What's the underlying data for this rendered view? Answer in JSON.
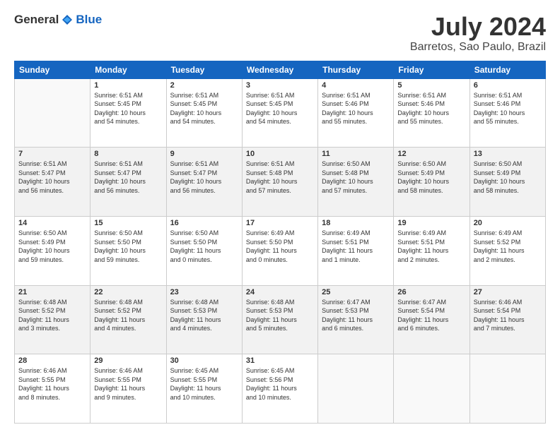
{
  "header": {
    "logo_general": "General",
    "logo_blue": "Blue",
    "month": "July 2024",
    "location": "Barretos, Sao Paulo, Brazil"
  },
  "days_of_week": [
    "Sunday",
    "Monday",
    "Tuesday",
    "Wednesday",
    "Thursday",
    "Friday",
    "Saturday"
  ],
  "weeks": [
    [
      {
        "day": "",
        "info": ""
      },
      {
        "day": "1",
        "info": "Sunrise: 6:51 AM\nSunset: 5:45 PM\nDaylight: 10 hours\nand 54 minutes."
      },
      {
        "day": "2",
        "info": "Sunrise: 6:51 AM\nSunset: 5:45 PM\nDaylight: 10 hours\nand 54 minutes."
      },
      {
        "day": "3",
        "info": "Sunrise: 6:51 AM\nSunset: 5:45 PM\nDaylight: 10 hours\nand 54 minutes."
      },
      {
        "day": "4",
        "info": "Sunrise: 6:51 AM\nSunset: 5:46 PM\nDaylight: 10 hours\nand 55 minutes."
      },
      {
        "day": "5",
        "info": "Sunrise: 6:51 AM\nSunset: 5:46 PM\nDaylight: 10 hours\nand 55 minutes."
      },
      {
        "day": "6",
        "info": "Sunrise: 6:51 AM\nSunset: 5:46 PM\nDaylight: 10 hours\nand 55 minutes."
      }
    ],
    [
      {
        "day": "7",
        "info": "Sunrise: 6:51 AM\nSunset: 5:47 PM\nDaylight: 10 hours\nand 56 minutes."
      },
      {
        "day": "8",
        "info": "Sunrise: 6:51 AM\nSunset: 5:47 PM\nDaylight: 10 hours\nand 56 minutes."
      },
      {
        "day": "9",
        "info": "Sunrise: 6:51 AM\nSunset: 5:47 PM\nDaylight: 10 hours\nand 56 minutes."
      },
      {
        "day": "10",
        "info": "Sunrise: 6:51 AM\nSunset: 5:48 PM\nDaylight: 10 hours\nand 57 minutes."
      },
      {
        "day": "11",
        "info": "Sunrise: 6:50 AM\nSunset: 5:48 PM\nDaylight: 10 hours\nand 57 minutes."
      },
      {
        "day": "12",
        "info": "Sunrise: 6:50 AM\nSunset: 5:49 PM\nDaylight: 10 hours\nand 58 minutes."
      },
      {
        "day": "13",
        "info": "Sunrise: 6:50 AM\nSunset: 5:49 PM\nDaylight: 10 hours\nand 58 minutes."
      }
    ],
    [
      {
        "day": "14",
        "info": "Sunrise: 6:50 AM\nSunset: 5:49 PM\nDaylight: 10 hours\nand 59 minutes."
      },
      {
        "day": "15",
        "info": "Sunrise: 6:50 AM\nSunset: 5:50 PM\nDaylight: 10 hours\nand 59 minutes."
      },
      {
        "day": "16",
        "info": "Sunrise: 6:50 AM\nSunset: 5:50 PM\nDaylight: 11 hours\nand 0 minutes."
      },
      {
        "day": "17",
        "info": "Sunrise: 6:49 AM\nSunset: 5:50 PM\nDaylight: 11 hours\nand 0 minutes."
      },
      {
        "day": "18",
        "info": "Sunrise: 6:49 AM\nSunset: 5:51 PM\nDaylight: 11 hours\nand 1 minute."
      },
      {
        "day": "19",
        "info": "Sunrise: 6:49 AM\nSunset: 5:51 PM\nDaylight: 11 hours\nand 2 minutes."
      },
      {
        "day": "20",
        "info": "Sunrise: 6:49 AM\nSunset: 5:52 PM\nDaylight: 11 hours\nand 2 minutes."
      }
    ],
    [
      {
        "day": "21",
        "info": "Sunrise: 6:48 AM\nSunset: 5:52 PM\nDaylight: 11 hours\nand 3 minutes."
      },
      {
        "day": "22",
        "info": "Sunrise: 6:48 AM\nSunset: 5:52 PM\nDaylight: 11 hours\nand 4 minutes."
      },
      {
        "day": "23",
        "info": "Sunrise: 6:48 AM\nSunset: 5:53 PM\nDaylight: 11 hours\nand 4 minutes."
      },
      {
        "day": "24",
        "info": "Sunrise: 6:48 AM\nSunset: 5:53 PM\nDaylight: 11 hours\nand 5 minutes."
      },
      {
        "day": "25",
        "info": "Sunrise: 6:47 AM\nSunset: 5:53 PM\nDaylight: 11 hours\nand 6 minutes."
      },
      {
        "day": "26",
        "info": "Sunrise: 6:47 AM\nSunset: 5:54 PM\nDaylight: 11 hours\nand 6 minutes."
      },
      {
        "day": "27",
        "info": "Sunrise: 6:46 AM\nSunset: 5:54 PM\nDaylight: 11 hours\nand 7 minutes."
      }
    ],
    [
      {
        "day": "28",
        "info": "Sunrise: 6:46 AM\nSunset: 5:55 PM\nDaylight: 11 hours\nand 8 minutes."
      },
      {
        "day": "29",
        "info": "Sunrise: 6:46 AM\nSunset: 5:55 PM\nDaylight: 11 hours\nand 9 minutes."
      },
      {
        "day": "30",
        "info": "Sunrise: 6:45 AM\nSunset: 5:55 PM\nDaylight: 11 hours\nand 10 minutes."
      },
      {
        "day": "31",
        "info": "Sunrise: 6:45 AM\nSunset: 5:56 PM\nDaylight: 11 hours\nand 10 minutes."
      },
      {
        "day": "",
        "info": ""
      },
      {
        "day": "",
        "info": ""
      },
      {
        "day": "",
        "info": ""
      }
    ]
  ]
}
